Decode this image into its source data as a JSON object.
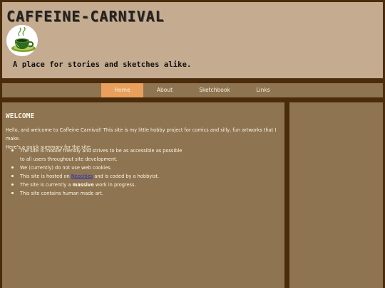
{
  "header": {
    "title": "CAFFEINE-CARNIVAL",
    "tagline": "A place for stories and sketches alike.",
    "logo": "green-coffee-cup-logo"
  },
  "nav": {
    "items": [
      {
        "label": "Home",
        "active": true
      },
      {
        "label": "About",
        "active": false
      },
      {
        "label": "Sketchbook",
        "active": false
      },
      {
        "label": "Links",
        "active": false
      }
    ]
  },
  "main": {
    "heading": "WELCOME",
    "intro_1": "Hello, and welcome to Caffeine Carnival! This site is my little hobby project for comics and silly, fun artworks that I make.",
    "intro_2": "Here's a quick summary for the site:",
    "list": {
      "item_1_line_1": "The site is mobile friendly and strives to be as accessible as possible",
      "item_1_line_2": "to all users throughout site development.",
      "item_2": "We (currently) do not use web cookies.",
      "item_3_pre": "This site is hosted on ",
      "item_3_link": "Neocities",
      "item_3_post": " and is coded by a hobbyist.",
      "item_4_pre": "The site is currently a ",
      "item_4_bold": "massive",
      "item_4_post": " work in progress.",
      "item_5": "This site contains human made art."
    }
  },
  "colors": {
    "background": "#4a2c0c",
    "header": "#c5ac91",
    "panel": "#8e7450",
    "nav_active": "#e8a05c",
    "link": "#2231c4"
  }
}
